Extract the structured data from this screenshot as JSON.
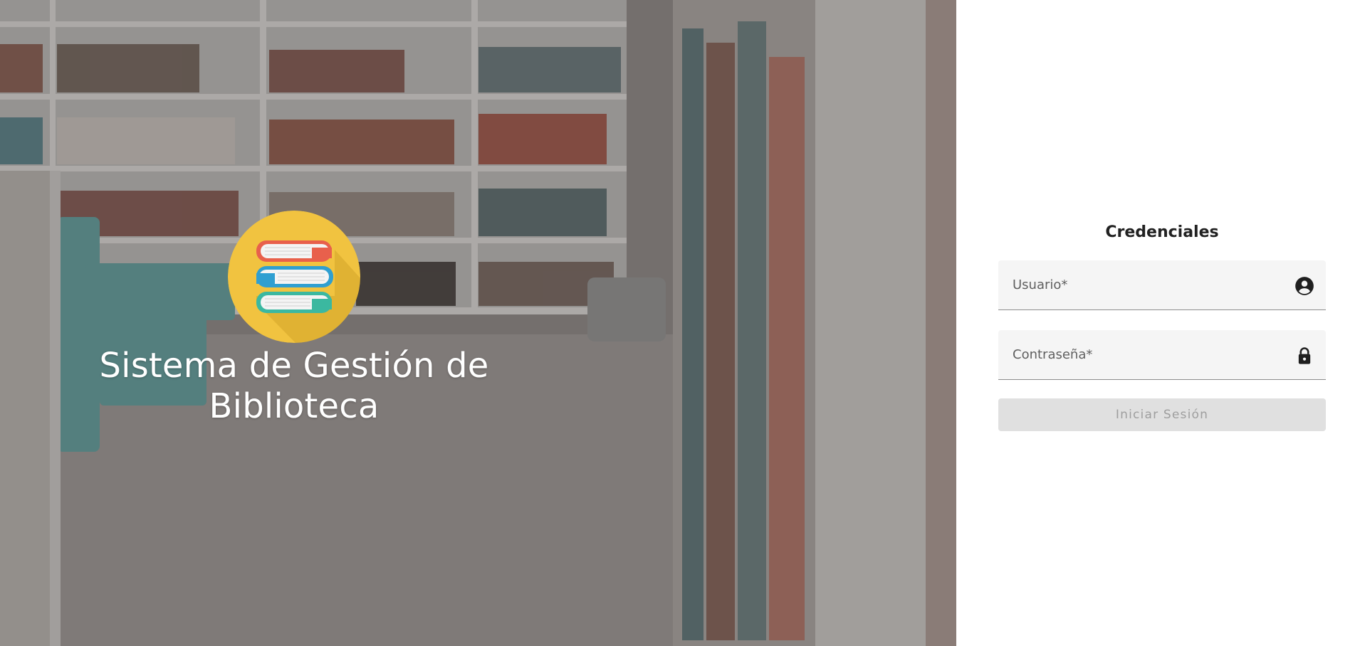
{
  "hero": {
    "background": "library-bookshelves-photo",
    "logo_icon": "books-stack-icon",
    "title": "Sistema de Gestión de Biblioteca"
  },
  "login": {
    "title": "Credenciales",
    "username": {
      "placeholder": "Usuario*",
      "icon": "account-circle-icon"
    },
    "password": {
      "placeholder": "Contraseña*",
      "icon": "lock-icon"
    },
    "submit_label": "Iniciar Sesión",
    "submit_state": "disabled"
  },
  "colors": {
    "logo_circle": "#f1c340",
    "book_red": "#e8604c",
    "book_blue": "#2f9fd1",
    "book_green": "#3bb8a0",
    "field_bg": "#f5f5f5",
    "button_disabled_bg": "#e0e0e0",
    "button_disabled_text": "#9e9e9e"
  }
}
